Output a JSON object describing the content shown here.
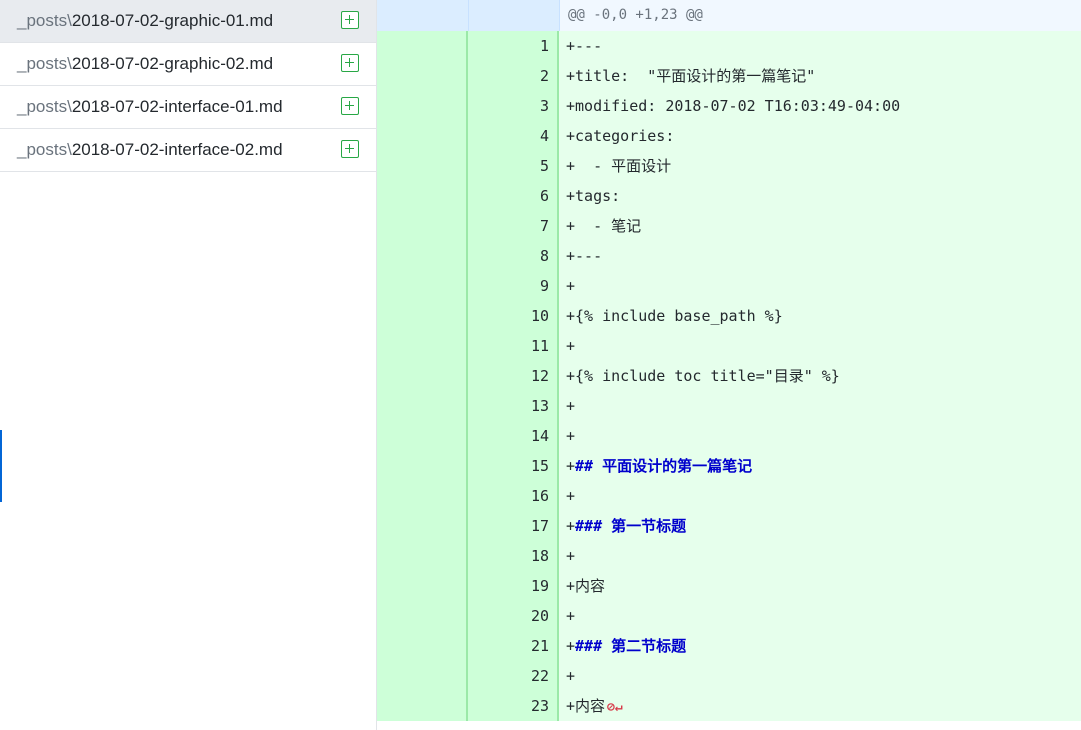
{
  "files": [
    {
      "dir": "_posts\\",
      "name": "2018-07-02-graphic-01.md",
      "selected": true
    },
    {
      "dir": "_posts\\",
      "name": "2018-07-02-graphic-02.md",
      "selected": false
    },
    {
      "dir": "_posts\\",
      "name": "2018-07-02-interface-01.md",
      "selected": false
    },
    {
      "dir": "_posts\\",
      "name": "2018-07-02-interface-02.md",
      "selected": false
    }
  ],
  "file_status_icon": "add-file-icon",
  "hunk_header": "@@ -0,0 +1,23 @@",
  "lines": [
    {
      "n": "1",
      "prefix": "+",
      "text": "---"
    },
    {
      "n": "2",
      "prefix": "+",
      "text": "title:  \"平面设计的第一篇笔记\""
    },
    {
      "n": "3",
      "prefix": "+",
      "text": "modified: 2018-07-02 T16:03:49-04:00"
    },
    {
      "n": "4",
      "prefix": "+",
      "text": "categories:"
    },
    {
      "n": "5",
      "prefix": "+",
      "text": "  - 平面设计"
    },
    {
      "n": "6",
      "prefix": "+",
      "text": "tags:"
    },
    {
      "n": "7",
      "prefix": "+",
      "text": "  - 笔记"
    },
    {
      "n": "8",
      "prefix": "+",
      "text": "---"
    },
    {
      "n": "9",
      "prefix": "+",
      "text": ""
    },
    {
      "n": "10",
      "prefix": "+",
      "text": "{% include base_path %}"
    },
    {
      "n": "11",
      "prefix": "+",
      "text": ""
    },
    {
      "n": "12",
      "prefix": "+",
      "text": "{% include toc title=\"目录\" %}"
    },
    {
      "n": "13",
      "prefix": "+",
      "text": ""
    },
    {
      "n": "14",
      "prefix": "+",
      "text": ""
    },
    {
      "n": "15",
      "prefix": "+",
      "text": "## 平面设计的第一篇笔记",
      "heading": true
    },
    {
      "n": "16",
      "prefix": "+",
      "text": ""
    },
    {
      "n": "17",
      "prefix": "+",
      "text": "### 第一节标题",
      "heading": true
    },
    {
      "n": "18",
      "prefix": "+",
      "text": ""
    },
    {
      "n": "19",
      "prefix": "+",
      "text": "内容"
    },
    {
      "n": "20",
      "prefix": "+",
      "text": ""
    },
    {
      "n": "21",
      "prefix": "+",
      "text": "### 第二节标题",
      "heading": true
    },
    {
      "n": "22",
      "prefix": "+",
      "text": ""
    },
    {
      "n": "23",
      "prefix": "+",
      "text": "内容",
      "eol": "⊘↵"
    }
  ],
  "colors": {
    "added_gutter": "#cdffd8",
    "added_code": "#e6ffec",
    "hunk_bg": "#f1f8ff",
    "heading": "#0000cc",
    "add_icon": "#28a745",
    "no_newline_marker": "#d73a49"
  }
}
